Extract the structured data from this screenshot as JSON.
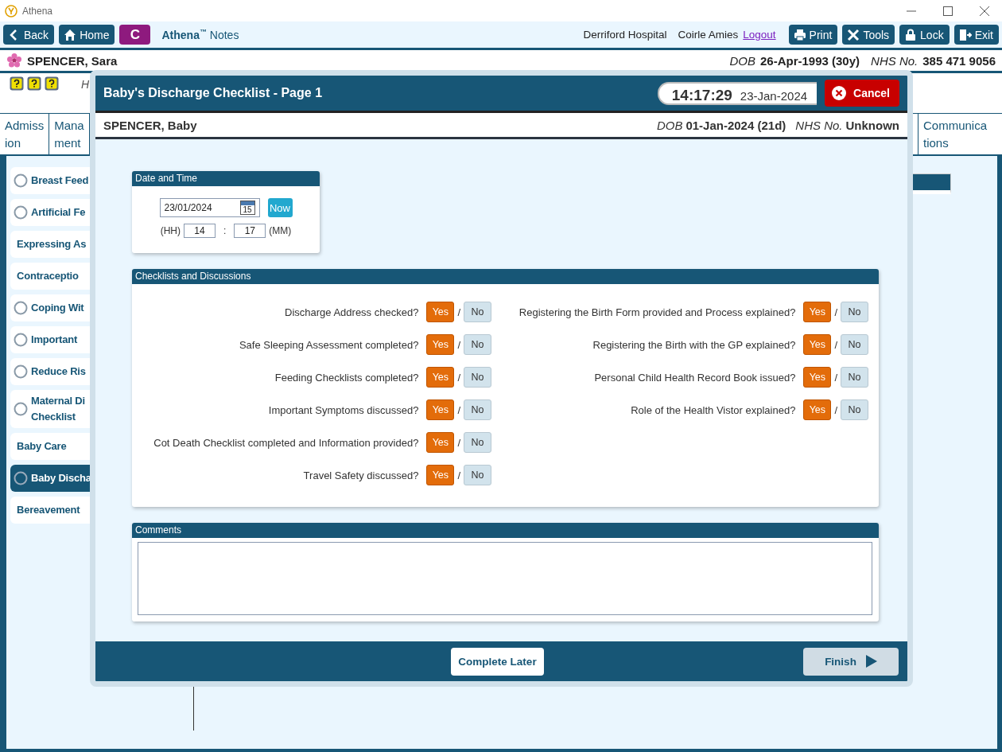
{
  "window": {
    "title": "Athena"
  },
  "toolbar": {
    "buttons": [
      {
        "label": "Back"
      },
      {
        "label": "Home"
      }
    ],
    "badge": "C",
    "brand": "Athena",
    "brand_mark": "™",
    "app": "Notes",
    "hospital": "Derriford Hospital",
    "user": "Coirle Amies",
    "logout": "Logout",
    "actions": [
      {
        "label": "Print"
      },
      {
        "label": "Tools"
      },
      {
        "label": "Lock"
      },
      {
        "label": "Exit"
      }
    ]
  },
  "patient": {
    "name": "SPENCER, Sara",
    "dob_label": "DOB",
    "dob": "26-Apr-1993 (30y)",
    "nhs_label": "NHS No.",
    "nhs": "385 471 9056",
    "cut_text": "H"
  },
  "tabs": [
    {
      "lines": [
        "Admiss",
        "ion"
      ]
    },
    {
      "lines": [
        "Mana",
        "ment"
      ]
    },
    {
      "lines": [
        "Communica",
        "tions"
      ]
    }
  ],
  "sidebar": {
    "items": [
      {
        "lines": [
          "Breast Feed"
        ],
        "kind": "radio",
        "selected": false
      },
      {
        "lines": [
          "Artificial Fe"
        ],
        "kind": "radio",
        "selected": false
      },
      {
        "lines": [
          "Expressing As"
        ],
        "kind": "plain",
        "selected": false
      },
      {
        "lines": [
          "Contraceptio"
        ],
        "kind": "plain",
        "selected": false
      },
      {
        "lines": [
          "Coping Wit"
        ],
        "kind": "radio",
        "selected": false
      },
      {
        "lines": [
          "Important"
        ],
        "kind": "radio",
        "selected": false
      },
      {
        "lines": [
          "Reduce Ris"
        ],
        "kind": "radio",
        "selected": false
      },
      {
        "lines": [
          "Maternal Di",
          "Checklist"
        ],
        "kind": "radio",
        "selected": false
      },
      {
        "lines": [
          "Baby Care"
        ],
        "kind": "plain",
        "selected": false
      },
      {
        "lines": [
          "Baby Discha"
        ],
        "kind": "radio",
        "selected": true
      },
      {
        "lines": [
          "Bereavement"
        ],
        "kind": "plain",
        "selected": false
      }
    ]
  },
  "dialog": {
    "title": "Baby's Discharge Checklist - Page 1",
    "time": "14:17:29",
    "date": "23-Jan-2024",
    "cancel": "Cancel",
    "baby": {
      "name": "SPENCER, Baby",
      "dob_label": "DOB",
      "dob": "01-Jan-2024 (21d)",
      "nhs_label": "NHS No.",
      "nhs": "Unknown"
    },
    "date_time": {
      "title": "Date and Time",
      "date": "23/01/2024",
      "calendar_day": "15",
      "now": "Now",
      "hh_label": "(HH)",
      "hh": "14",
      "sep": ":",
      "mm": "17",
      "mm_label": "(MM)"
    },
    "checklist": {
      "title": "Checklists and Discussions",
      "columns": [
        [
          {
            "question": "Discharge Address checked?",
            "yes": "Yes",
            "no": "No",
            "separator": "/",
            "yes_selected": true,
            "no_selected": false
          },
          {
            "question": "Safe Sleeping Assessment completed?",
            "yes": "Yes",
            "no": "No",
            "separator": "/",
            "yes_selected": true,
            "no_selected": false
          },
          {
            "question": "Feeding Checklists completed?",
            "yes": "Yes",
            "no": "No",
            "separator": "/",
            "yes_selected": true,
            "no_selected": false
          },
          {
            "question": "Important Symptoms discussed?",
            "yes": "Yes",
            "no": "No",
            "separator": "/",
            "yes_selected": true,
            "no_selected": false
          },
          {
            "question": "Cot Death Checklist completed and Information provided?",
            "yes": "Yes",
            "no": "No",
            "separator": "/",
            "yes_selected": true,
            "no_selected": false
          },
          {
            "question": "Travel Safety discussed?",
            "yes": "Yes",
            "no": "No",
            "separator": "/",
            "yes_selected": true,
            "no_selected": false
          }
        ],
        [
          {
            "question": "Registering the Birth Form provided and Process explained?",
            "yes": "Yes",
            "no": "No",
            "separator": "/",
            "yes_selected": true,
            "no_selected": false
          },
          {
            "question": "Registering the Birth with the GP explained?",
            "yes": "Yes",
            "no": "No",
            "separator": "/",
            "yes_selected": true,
            "no_selected": false
          },
          {
            "question": "Personal Child Health Record Book issued?",
            "yes": "Yes",
            "no": "No",
            "separator": "/",
            "yes_selected": true,
            "no_selected": false
          },
          {
            "question": "Role of the Health Vistor explained?",
            "yes": "Yes",
            "no": "No",
            "separator": "/",
            "yes_selected": true,
            "no_selected": false
          }
        ]
      ]
    },
    "comments": {
      "title": "Comments"
    },
    "footer": {
      "complete_later": "Complete Later",
      "finish": "Finish",
      "finish_disabled": true
    }
  }
}
